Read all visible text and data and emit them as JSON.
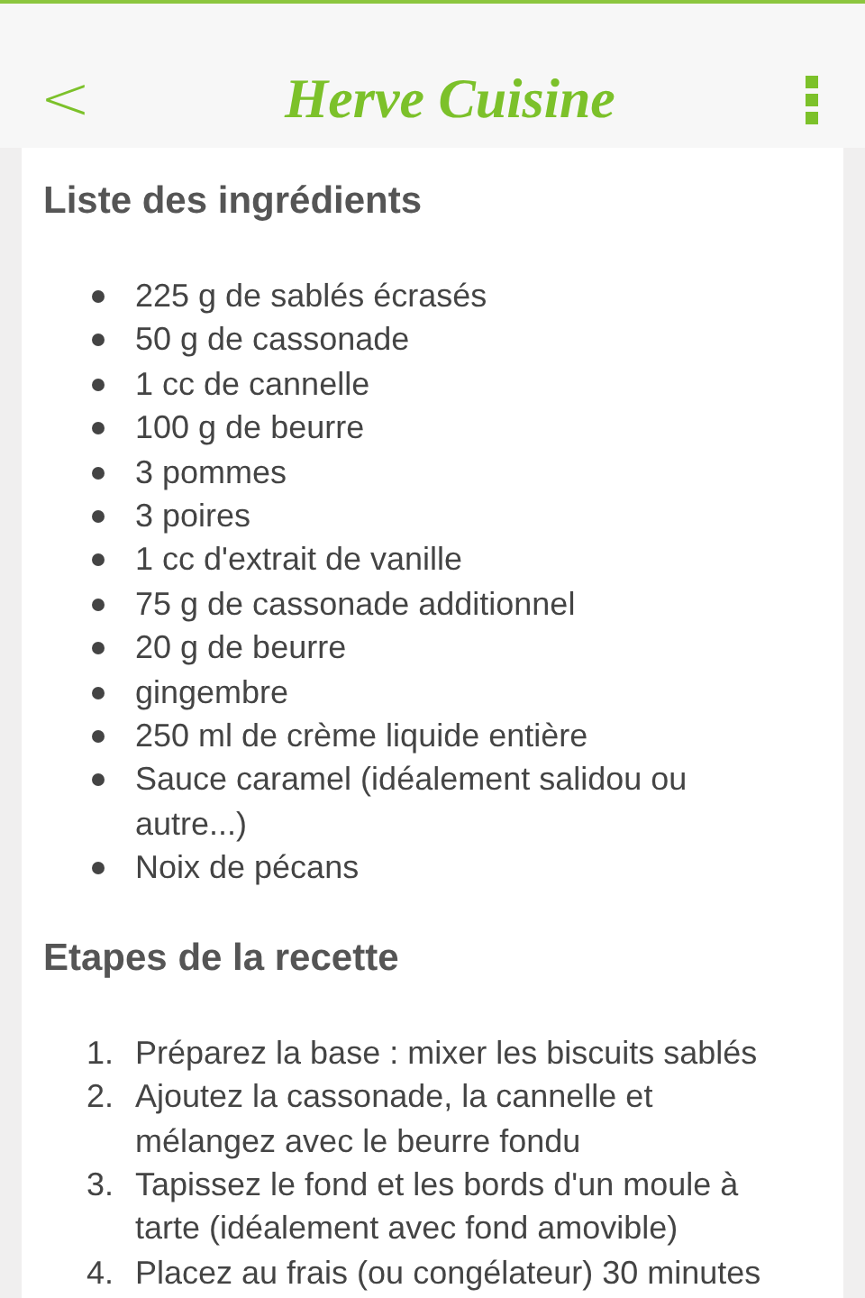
{
  "header": {
    "back": "<",
    "logo": "Herve Cuisine"
  },
  "ingredients": {
    "title": "Liste des ingrédients",
    "items": [
      "225 g de sablés écrasés",
      "50 g de cassonade",
      "1 cc de cannelle",
      "100 g de beurre",
      "3 pommes",
      "3 poires",
      "1 cc d'extrait de vanille",
      "75 g de cassonade additionnel",
      "20 g de beurre",
      "gingembre",
      "250 ml de crème liquide entière",
      "Sauce caramel (idéalement salidou ou autre...)",
      "Noix de pécans"
    ]
  },
  "steps": {
    "title": "Etapes de la recette",
    "items": [
      {
        "number": "1.",
        "text": "Préparez la base : mixer les biscuits sablés"
      },
      {
        "number": "2.",
        "text": "Ajoutez la cassonade, la cannelle et mélangez avec le beurre fondu"
      },
      {
        "number": "3.",
        "text": "Tapissez le fond et les bords d'un moule à tarte (idéalement avec fond amovible)"
      },
      {
        "number": "4.",
        "text": "Placez au frais (ou congélateur) 30 minutes"
      }
    ]
  }
}
